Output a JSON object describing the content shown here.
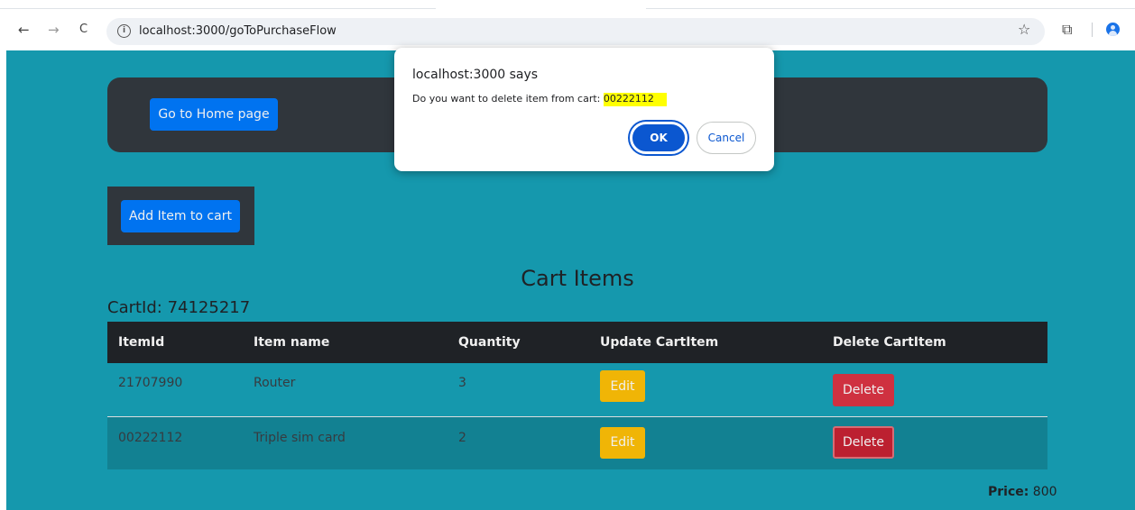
{
  "browser": {
    "back_icon": "←",
    "forward_icon": "→",
    "reload_icon": "C",
    "info_icon": "i",
    "url": "localhost:3000/goToPurchaseFlow",
    "bookmark_icon": "☆",
    "extensions_icon": "⧉"
  },
  "page": {
    "home_button": "Go to Home page",
    "add_item_button": "Add Item to cart",
    "title": "Cart Items",
    "cart_id": "CartId: 74125217",
    "table": {
      "headers": [
        "ItemId",
        "Item name",
        "Quantity",
        "Update CartItem",
        "Delete CartItem"
      ],
      "rows": [
        {
          "item_id": "21707990",
          "item_name": "Router",
          "quantity": "3",
          "edit": "Edit",
          "delete": "Delete"
        },
        {
          "item_id": "00222112",
          "item_name": "Triple sim card",
          "quantity": "2",
          "edit": "Edit",
          "delete": "Delete"
        }
      ]
    },
    "price_label": "Price:",
    "price_value": " 800"
  },
  "dialog": {
    "title": "localhost:3000 says",
    "message": "Do you want to delete item from cart: ",
    "highlighted_id": "00222112",
    "ok": "OK",
    "cancel": "Cancel"
  },
  "colors": {
    "page_background": "#17a2b8",
    "panel": "#343a40",
    "primary": "#007bff",
    "warning": "#ffc107",
    "danger": "#dc3545",
    "dialog_accent": "#0b57d0",
    "highlight": "#ffff00"
  }
}
